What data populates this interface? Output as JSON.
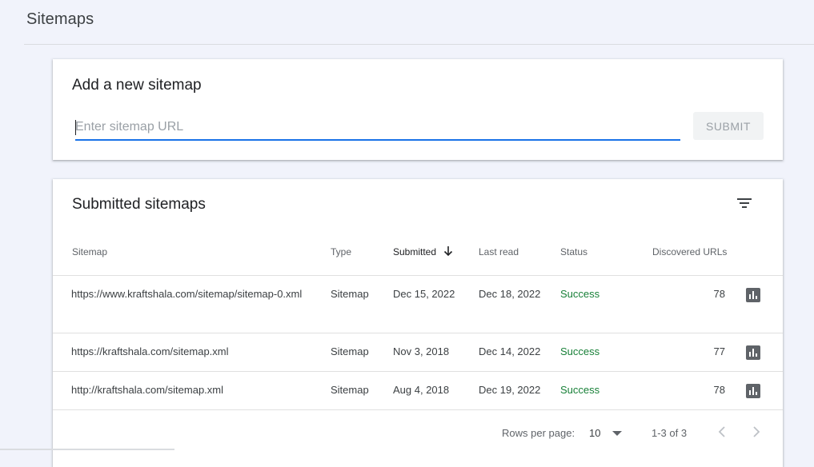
{
  "header": {
    "title": "Sitemaps"
  },
  "add_card": {
    "title": "Add a new sitemap",
    "input_placeholder": "Enter sitemap URL",
    "input_value": "",
    "submit_label": "SUBMIT"
  },
  "list_card": {
    "title": "Submitted sitemaps",
    "columns": {
      "sitemap": "Sitemap",
      "type": "Type",
      "submitted": "Submitted",
      "last_read": "Last read",
      "status": "Status",
      "discovered": "Discovered URLs"
    },
    "rows": [
      {
        "sitemap": "https://www.kraftshala.com/sitemap/sitemap-0.xml",
        "type": "Sitemap",
        "submitted": "Dec 15, 2022",
        "last_read": "Dec 18, 2022",
        "status": "Success",
        "discovered": "78"
      },
      {
        "sitemap": "https://kraftshala.com/sitemap.xml",
        "type": "Sitemap",
        "submitted": "Nov 3, 2018",
        "last_read": "Dec 14, 2022",
        "status": "Success",
        "discovered": "77"
      },
      {
        "sitemap": "http://kraftshala.com/sitemap.xml",
        "type": "Sitemap",
        "submitted": "Aug 4, 2018",
        "last_read": "Dec 19, 2022",
        "status": "Success",
        "discovered": "78"
      }
    ],
    "footer": {
      "rows_per_page_label": "Rows per page:",
      "rows_per_page_value": "10",
      "range": "1-3 of 3"
    }
  },
  "colors": {
    "accent": "#1a73e8",
    "success": "#188038",
    "background": "#f1f3fb"
  },
  "icons": {
    "filter": "filter-icon",
    "sort": "arrow-down-icon",
    "row_action": "bar-chart-icon",
    "prev": "chevron-left-icon",
    "next": "chevron-right-icon"
  }
}
